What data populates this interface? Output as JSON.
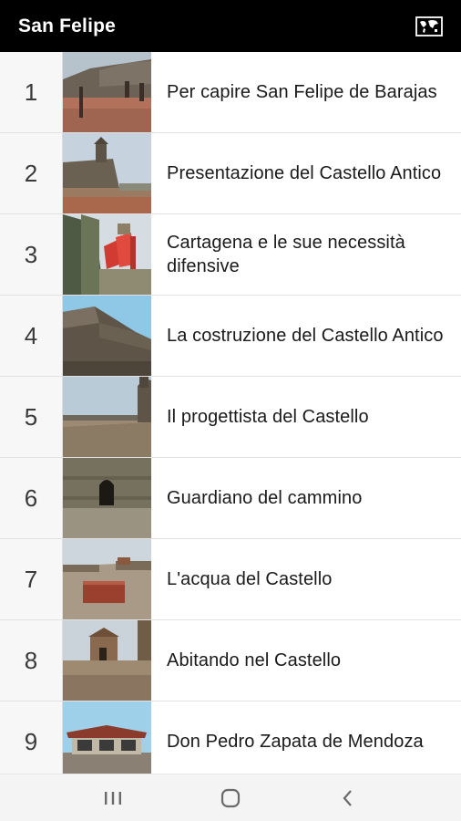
{
  "app_bar": {
    "title": "San Felipe",
    "map_button_icon": "world-map-icon"
  },
  "list": {
    "items": [
      {
        "number": "1",
        "title": "Per capire San Felipe de Barajas",
        "thumbnail": "fortress-courtyard-photo"
      },
      {
        "number": "2",
        "title": "Presentazione del Castello Antico",
        "thumbnail": "castle-tower-photo"
      },
      {
        "number": "3",
        "title": "Cartagena e le sue necessità difensive",
        "thumbnail": "wall-red-structure-photo"
      },
      {
        "number": "4",
        "title": "La costruzione del Castello Antico",
        "thumbnail": "castle-bastion-photo"
      },
      {
        "number": "5",
        "title": "Il progettista del Castello",
        "thumbnail": "fortress-terrace-photo"
      },
      {
        "number": "6",
        "title": "Guardiano del cammino",
        "thumbnail": "tunnel-entrance-photo"
      },
      {
        "number": "7",
        "title": "L'acqua del Castello",
        "thumbnail": "water-cistern-photo"
      },
      {
        "number": "8",
        "title": "Abitando nel Castello",
        "thumbnail": "inner-buildings-photo"
      },
      {
        "number": "9",
        "title": "Don Pedro Zapata de Mendoza",
        "thumbnail": "kiosk-photo"
      }
    ]
  },
  "nav_bar": {
    "recents_icon": "recent-apps-icon",
    "home_icon": "home-icon",
    "back_icon": "back-icon"
  }
}
